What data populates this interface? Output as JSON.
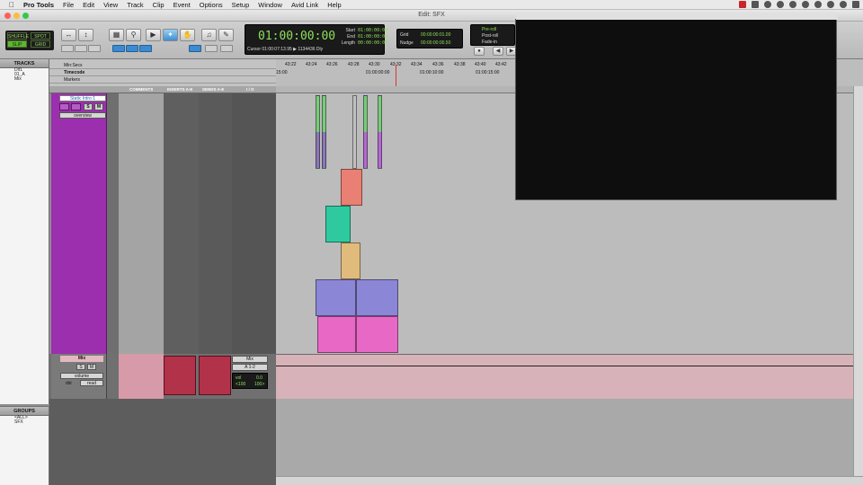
{
  "menubar": {
    "items": [
      "Pro Tools",
      "File",
      "Edit",
      "View",
      "Track",
      "Clip",
      "Event",
      "Options",
      "Setup",
      "Window",
      "Avid Link",
      "Help"
    ]
  },
  "window": {
    "title": "Edit: SFX"
  },
  "toolbar": {
    "modes": {
      "shuffle": "SHUFFLE",
      "spot": "SPOT",
      "slip": "SLIP",
      "grid": "GRID"
    },
    "counter": {
      "main": "01:00:00:00",
      "labels": {
        "start": "Start",
        "end": "End",
        "length": "Length"
      },
      "start": "01:00:00:00",
      "end": "01:00:00:00",
      "length": "00:00:00:00",
      "cursor_label": "Cursor",
      "cursor_value": "01:00:07:13.95",
      "samples": "1134436",
      "dly": "Dly"
    },
    "grid": {
      "grid_label": "Grid",
      "grid_value": "00:00:00:01.00",
      "nudge_label": "Nudge",
      "nudge_value": "00:00:00:00.50"
    },
    "preroll": {
      "preroll_label": "Pre-roll",
      "postroll_label": "Post-roll",
      "fadein_label": "Fade-in"
    }
  },
  "tracks_panel": {
    "title": "TRACKS",
    "items": [
      "Dif1",
      "01_A",
      "Mix"
    ]
  },
  "groups_panel": {
    "title": "GROUPS",
    "items": [
      "<ALL>",
      "SFX"
    ]
  },
  "rulers": {
    "minsecs": "Min:Secs",
    "timecode": "Timecode",
    "markers": "Markers"
  },
  "ruler_ticks": [
    "43:22",
    "43:24",
    "43:26",
    "43:28",
    "43:30",
    "43:32",
    "43:34",
    "43:36",
    "43:38",
    "43:40",
    "43:42"
  ],
  "timecode_ticks": [
    "15:00",
    "01:00:00:00",
    "01:00:10:00",
    "01:00:15:00"
  ],
  "column_headers": {
    "comments": "COMMENTS",
    "inserts": "INSERTS A-E",
    "sends": "SENDS A-E",
    "io": "I / O"
  },
  "track1": {
    "name": "Static Intro 1",
    "view": "overview",
    "solo": "S",
    "mute": "M"
  },
  "mix_track": {
    "name": "Mix",
    "playlist": "volume",
    "mode_label": "dst",
    "auto": "read",
    "io_out": "Mix",
    "io_in": "A 1-2",
    "vol_label": "vol",
    "vol_value": "0.0",
    "pan_l": "<100",
    "pan_r": "100>"
  },
  "colors": {
    "purple": "#9c2fae",
    "mix_pink": "#d7b3b9",
    "counter_green": "#8fe05a"
  }
}
